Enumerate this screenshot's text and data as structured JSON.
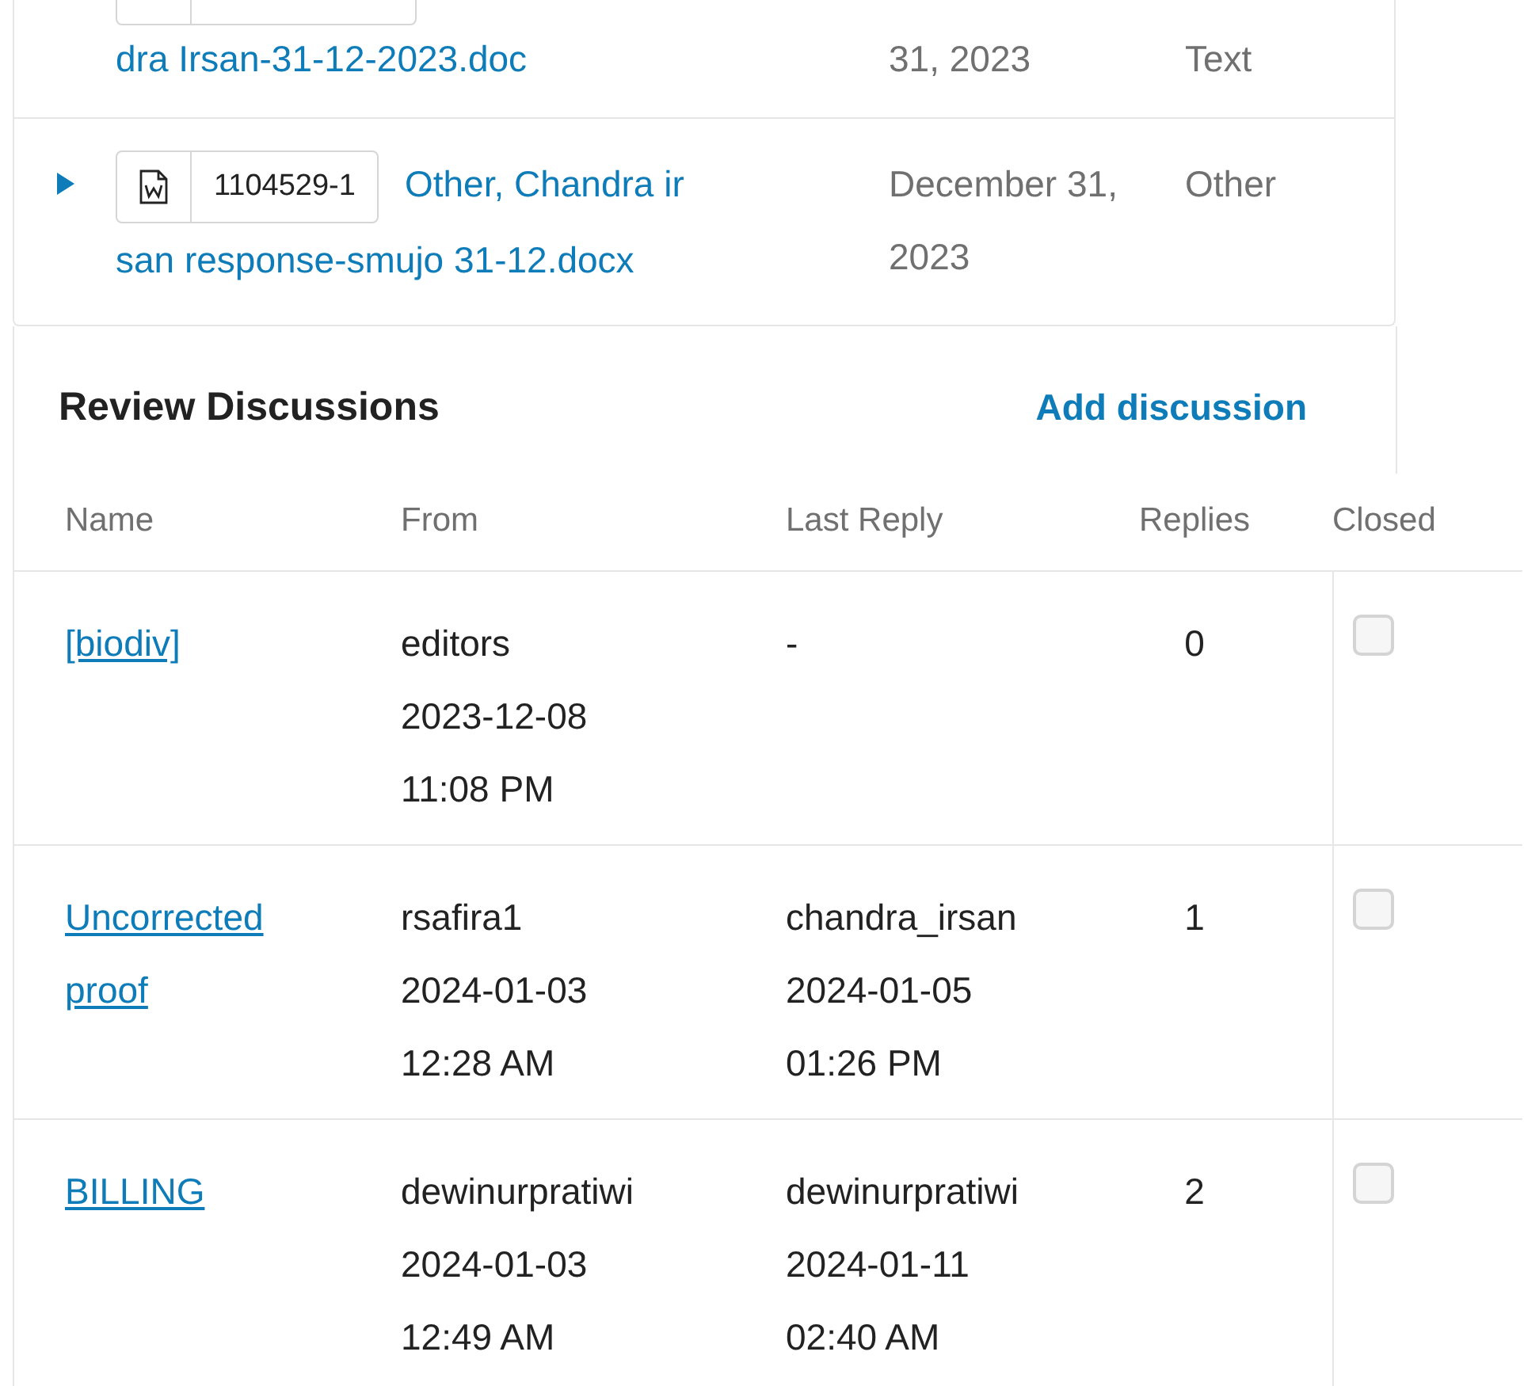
{
  "files": [
    {
      "kind": "cut",
      "title": "dra Irsan-31-12-2023.doc",
      "date": "31, 2023",
      "type": "Text"
    },
    {
      "kind": "full",
      "expanded": false,
      "number": "1104529-1",
      "title_lines": [
        "Other, Chandra ir",
        "san response-smujo 31-12.docx"
      ],
      "date": "December 31, 2023",
      "type": "Other"
    }
  ],
  "discussions": {
    "title": "Review Discussions",
    "add_link": "Add discussion",
    "columns": [
      "Name",
      "From",
      "Last Reply",
      "Replies",
      "Closed"
    ],
    "rows": [
      {
        "name": "[biodiv]",
        "from": [
          "editors",
          "2023-12-08",
          "11:08 PM"
        ],
        "last_reply": [
          "-"
        ],
        "replies": "0",
        "closed": false
      },
      {
        "name": "Uncorrected proof",
        "from": [
          "rsafira1",
          "2024-01-03",
          "12:28 AM"
        ],
        "last_reply": [
          "chandra_irsan",
          "2024-01-05",
          "01:26 PM"
        ],
        "replies": "1",
        "closed": false
      },
      {
        "name": "BILLING",
        "from": [
          "dewinurpratiwi",
          "2024-01-03",
          "12:49 AM"
        ],
        "last_reply": [
          "dewinurpratiwi",
          "2024-01-11",
          "02:40 AM"
        ],
        "replies": "2",
        "closed": false
      }
    ]
  }
}
